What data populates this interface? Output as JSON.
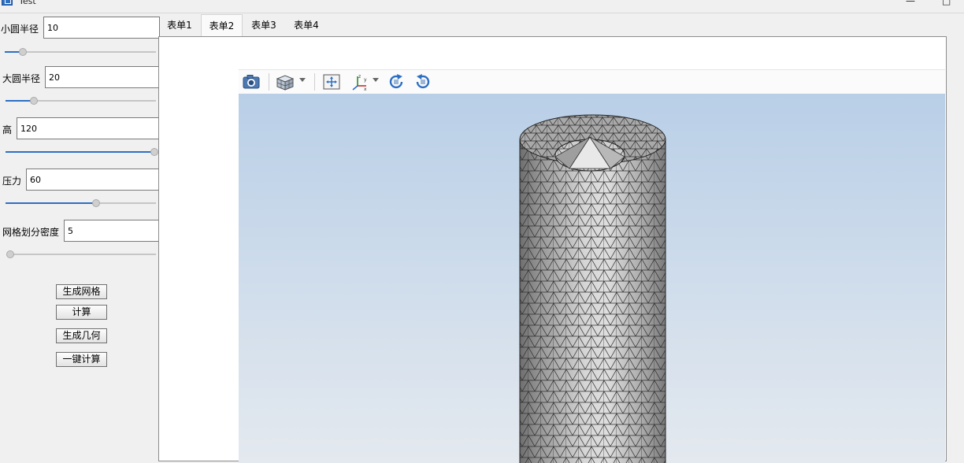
{
  "window": {
    "title": "Test",
    "minimize": "—",
    "maximize": "□"
  },
  "params": {
    "inner_radius": {
      "label": "小圆半径",
      "value": "10",
      "slider": 0.12
    },
    "outer_radius": {
      "label": "大圆半径",
      "value": "20",
      "slider": 0.19
    },
    "height": {
      "label": "高",
      "value": "120",
      "slider": 1.0
    },
    "pressure": {
      "label": "压力",
      "value": "60",
      "slider": 0.6
    },
    "mesh_density": {
      "label": "网格划分密度",
      "value": "5",
      "slider": 0.02
    }
  },
  "actions": {
    "generate_mesh": "生成网格",
    "compute": "计算",
    "generate_geometry": "生成几何",
    "one_click_compute": "一键计算"
  },
  "tabs": [
    "表单1",
    "表单2",
    "表单3",
    "表单4"
  ],
  "active_tab": 1,
  "viewer": {
    "toolbar": [
      "camera-icon",
      "view-cube-icon",
      "fit-all-icon",
      "axes-icon",
      "rotate-cw-icon",
      "rotate-ccw-icon"
    ],
    "model": "tetrahedral-mesh-hollow-cylinder",
    "background_top": "#b9cfe7",
    "background_bottom": "#e4e9ef"
  },
  "colors": {
    "accent": "#2d6fc4"
  }
}
